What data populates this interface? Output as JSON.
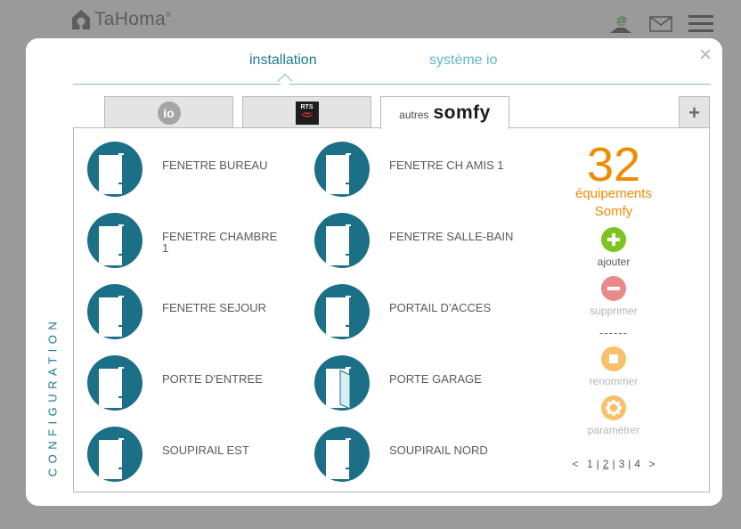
{
  "app": {
    "name": "TaHoma",
    "reg": "®"
  },
  "tabs": {
    "installation": "installation",
    "system": "système io"
  },
  "side_label": "CONFIGURATION",
  "protocol_tabs": {
    "io": "io",
    "rts": "RTS",
    "somfy_prefix": "autres",
    "somfy": "somfy"
  },
  "devices": [
    {
      "label": "FENETRE BUREAU",
      "icon": "window-icon"
    },
    {
      "label": "FENETRE CH AMIS 1",
      "icon": "window-icon"
    },
    {
      "label": "FENETRE CHAMBRE 1",
      "icon": "window-icon"
    },
    {
      "label": "FENETRE SALLE-BAIN",
      "icon": "window-icon"
    },
    {
      "label": "FENETRE SEJOUR",
      "icon": "window-icon"
    },
    {
      "label": "PORTAIL D'ACCES",
      "icon": "window-icon"
    },
    {
      "label": "PORTE D'ENTREE",
      "icon": "window-icon"
    },
    {
      "label": "PORTE GARAGE",
      "icon": "door-icon"
    },
    {
      "label": "SOUPIRAIL EST",
      "icon": "window-icon"
    },
    {
      "label": "SOUPIRAIL NORD",
      "icon": "window-icon"
    }
  ],
  "summary": {
    "count": "32",
    "line1": "équipements",
    "line2": "Somfy"
  },
  "actions": {
    "add": "ajouter",
    "remove": "supprimer",
    "separator": "------",
    "rename": "renommer",
    "settings": "paramètrer"
  },
  "pager": {
    "prev": "<",
    "pages": [
      "1",
      "2",
      "3",
      "4"
    ],
    "current": "2",
    "next": ">"
  },
  "colors": {
    "accent": "#1c7a90",
    "orange": "#f28a00",
    "green": "#7cc421",
    "red": "#e88a8a",
    "orange_light": "#f8c06a"
  }
}
